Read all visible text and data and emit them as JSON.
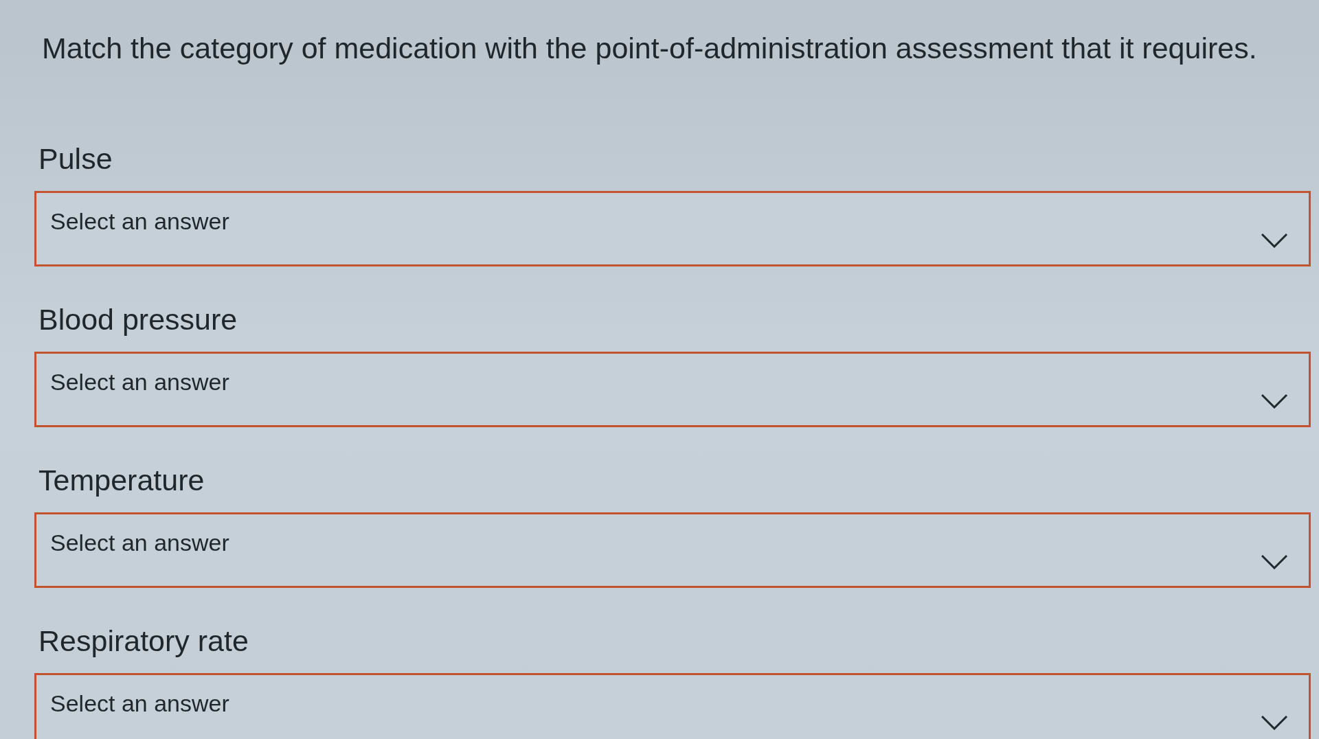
{
  "question": "Match the category of medication with the point-of-administration assessment that it requires.",
  "items": [
    {
      "label": "Pulse",
      "dropdown": {
        "placeholder": "Select an answer"
      }
    },
    {
      "label": "Blood pressure",
      "dropdown": {
        "placeholder": "Select an answer"
      }
    },
    {
      "label": "Temperature",
      "dropdown": {
        "placeholder": "Select an answer"
      }
    },
    {
      "label": "Respiratory rate",
      "dropdown": {
        "placeholder": "Select an answer"
      }
    }
  ]
}
